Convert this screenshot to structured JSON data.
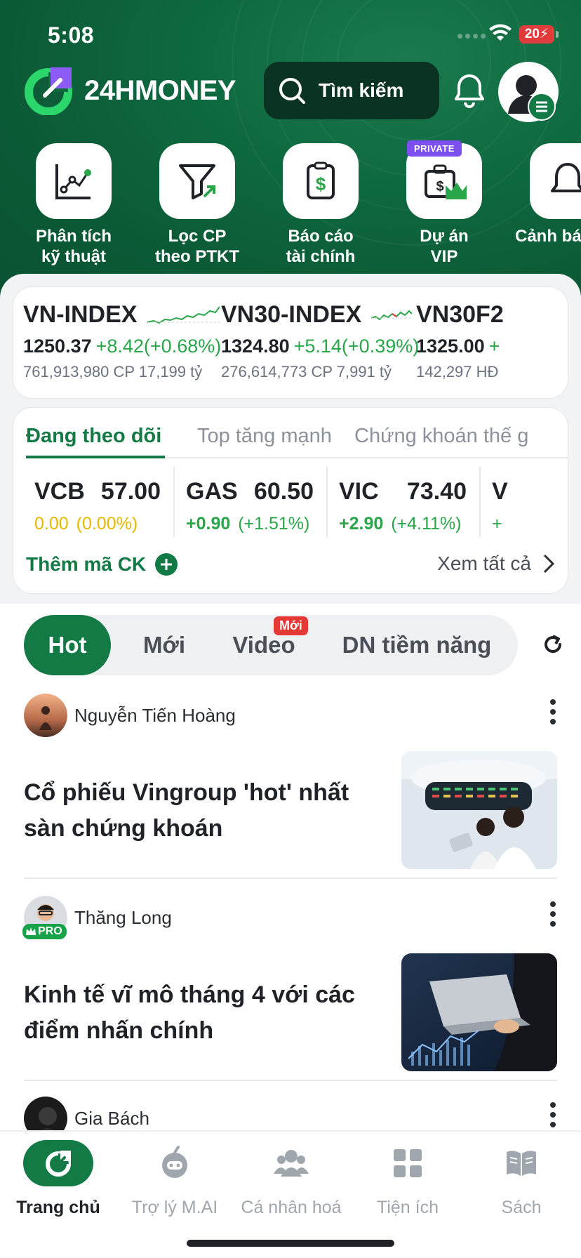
{
  "status": {
    "time": "5:08",
    "battery": "20"
  },
  "header": {
    "logo_text": "24HMONEY",
    "search_label": "Tìm kiếm"
  },
  "shortcuts": [
    {
      "label_1": "Phân tích",
      "label_2": "kỹ thuật",
      "icon": "chart-analysis-icon"
    },
    {
      "label_1": "Lọc CP",
      "label_2": "theo PTKT",
      "icon": "filter-icon"
    },
    {
      "label_1": "Báo cáo",
      "label_2": "tài chính",
      "icon": "financial-report-icon"
    },
    {
      "label_1": "Dự án",
      "label_2": "VIP",
      "icon": "vip-project-icon",
      "tag": "PRIVATE"
    },
    {
      "label_1": "Cảnh bá",
      "label_2": "",
      "icon": "alert-bell-icon"
    }
  ],
  "indices": [
    {
      "name": "VN-INDEX",
      "value": "1250.37",
      "change": "+8.42(+0.68%)",
      "volume": "761,913,980 CP 17,199 tỷ"
    },
    {
      "name": "VN30-INDEX",
      "value": "1324.80",
      "change": "+5.14(+0.39%)",
      "volume": "276,614,773 CP 7,991 tỷ"
    },
    {
      "name": "VN30F2",
      "value": "1325.00",
      "change": "+",
      "volume": "142,297 HĐ"
    }
  ],
  "watchlist": {
    "tabs": [
      "Đang theo dõi",
      "Top tăng mạnh",
      "Chứng khoán thế g"
    ],
    "stocks": [
      {
        "symbol": "VCB",
        "price": "57.00",
        "change": "0.00",
        "pct": "(0.00%)",
        "color": "#e6b800"
      },
      {
        "symbol": "GAS",
        "price": "60.50",
        "change": "+0.90",
        "pct": "(+1.51%)",
        "color": "#2aa64a"
      },
      {
        "symbol": "VIC",
        "price": "73.40",
        "change": "+2.90",
        "pct": "(+4.11%)",
        "color": "#2aa64a"
      },
      {
        "symbol": "V",
        "price": "",
        "change": "+",
        "pct": "",
        "color": "#2aa64a"
      }
    ],
    "add_label": "Thêm mã CK",
    "view_all_label": "Xem tất cả"
  },
  "feed": {
    "tabs": [
      "Hot",
      "Mới",
      "Video",
      "DN tiềm năng"
    ],
    "new_badge": "Mới",
    "posts": [
      {
        "author": "Nguyễn Tiến Hoàng",
        "title": "Cổ phiếu Vingroup 'hot' nhất sàn chứng khoán"
      },
      {
        "author": "Thăng Long",
        "badge": "PRO",
        "title": "Kinh tế vĩ mô tháng 4 với các điểm nhấn chính"
      },
      {
        "author": "Gia Bách"
      }
    ]
  },
  "bottom_nav": [
    {
      "label": "Trang chủ",
      "active": true
    },
    {
      "label": "Trợ lý M.AI"
    },
    {
      "label": "Cá nhân hoá"
    },
    {
      "label": "Tiện ích"
    },
    {
      "label": "Sách"
    }
  ],
  "colors": {
    "brand_green": "#137a45",
    "header_green": "#0f6a40",
    "up": "#2aa64a",
    "flat": "#e6b800"
  }
}
